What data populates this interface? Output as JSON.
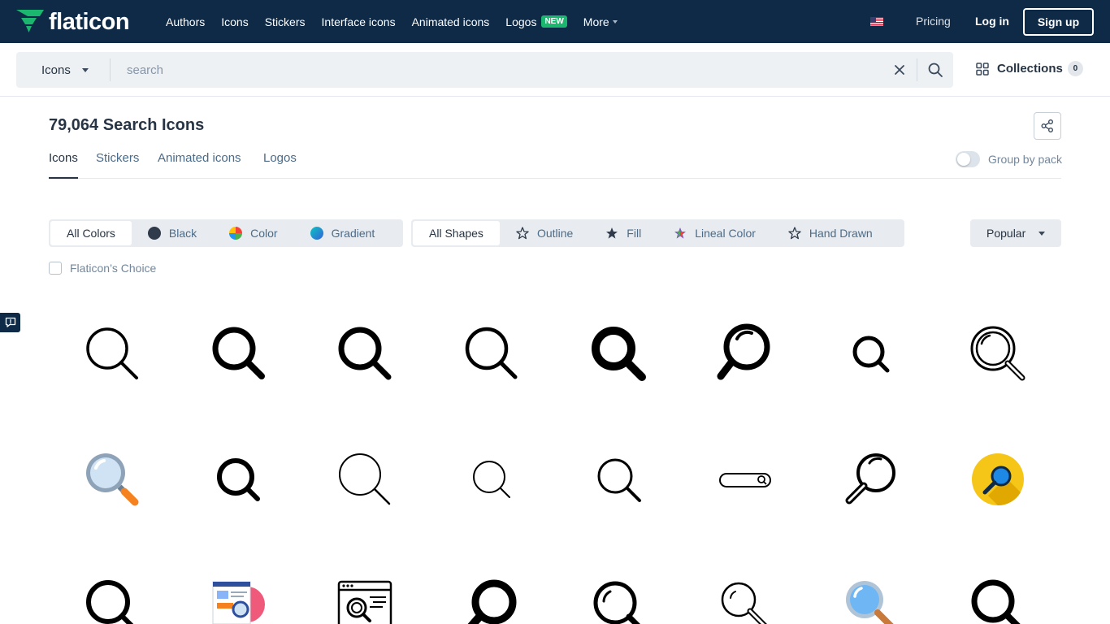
{
  "brand": {
    "name": "flaticon",
    "color": "#1bb76e",
    "navbar_bg": "#0e2a47"
  },
  "nav": {
    "items": [
      "Authors",
      "Icons",
      "Stickers",
      "Interface icons",
      "Animated icons",
      "Logos",
      "More"
    ],
    "new_badge": "NEW"
  },
  "header_right": {
    "locale_icon": "us-flag-icon",
    "pricing": "Pricing",
    "login": "Log in",
    "signup": "Sign up"
  },
  "search": {
    "type_selected": "Icons",
    "placeholder": "search",
    "value": ""
  },
  "collections": {
    "label": "Collections",
    "count": "0"
  },
  "results": {
    "title": "79,064 Search Icons"
  },
  "tabs": [
    "Icons",
    "Stickers",
    "Animated icons",
    "Logos"
  ],
  "active_tab": "Icons",
  "group_by_pack": {
    "label": "Group by pack",
    "enabled": false
  },
  "color_filters": [
    "All Colors",
    "Black",
    "Color",
    "Gradient"
  ],
  "shape_filters": [
    "All Shapes",
    "Outline",
    "Fill",
    "Lineal Color",
    "Hand Drawn"
  ],
  "sort": {
    "selected": "Popular"
  },
  "flaticon_choice": {
    "label": "Flaticon’s Choice",
    "checked": false
  },
  "icon_grid": [
    [
      "search-outline-thin-icon",
      "search-bold-icon",
      "search-bold-icon",
      "search-outline-icon",
      "search-extra-bold-icon",
      "search-glass-highlight-icon",
      "search-small-bold-icon",
      "search-double-ring-icon"
    ],
    [
      "magnifier-color-icon",
      "search-bold-icon",
      "search-thin-icon",
      "search-thin-small-icon",
      "search-outline-icon",
      "search-bar-icon",
      "search-rotated-icon",
      "search-yellow-circle-icon"
    ],
    [
      "search-bold-icon",
      "webpage-search-color-icon",
      "browser-search-icon",
      "search-extra-bold-icon",
      "search-highlight-icon",
      "magnifier-outline-icon",
      "magnifier-blue-icon",
      "search-bold-icon"
    ]
  ]
}
